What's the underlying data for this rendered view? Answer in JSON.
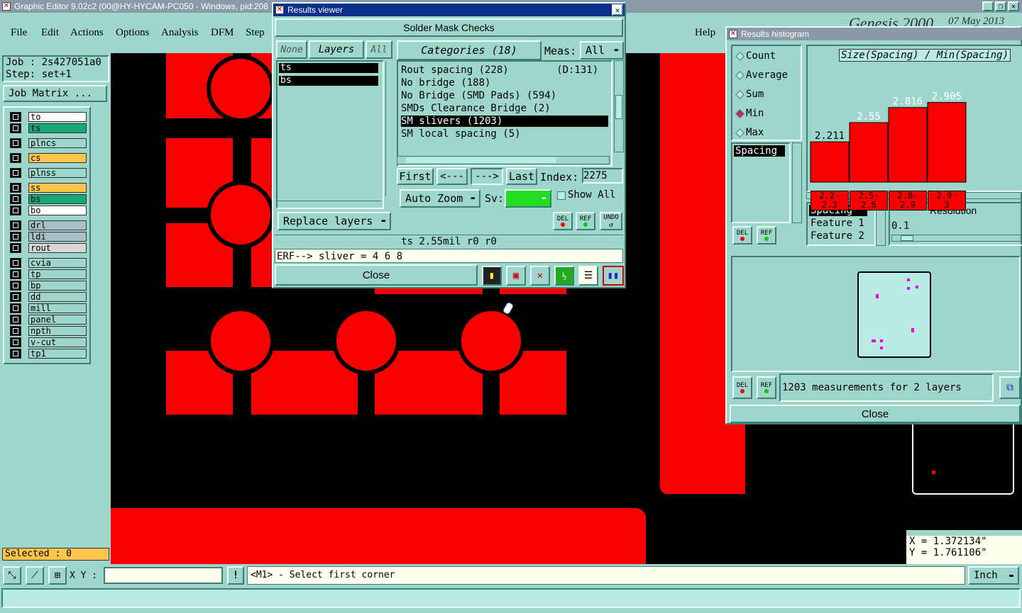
{
  "app_title": "Graphic Editor 9.02c2 (00@HY-HYCAM-PC050 - Windows, pid:208",
  "menu": [
    "File",
    "Edit",
    "Actions",
    "Options",
    "Analysis",
    "DFM",
    "Step"
  ],
  "help": "Help",
  "brand": "Genesis 2000",
  "date": "07 May 2013",
  "job": "Job : 2s427051a0",
  "step": "Step: set+1",
  "job_matrix": "Job Matrix ...",
  "layers": [
    {
      "name": "to",
      "color": "#ffffff"
    },
    {
      "name": "ts",
      "color": "#18a878"
    },
    {
      "name": "plncs",
      "color": "#9fd6cc"
    },
    {
      "name": "cs",
      "color": "#ffc44a"
    },
    {
      "name": "plnss",
      "color": "#9fd6cc"
    },
    {
      "name": "ss",
      "color": "#ffc44a"
    },
    {
      "name": "bs",
      "color": "#18a878"
    },
    {
      "name": "bo",
      "color": "#ffffff"
    },
    {
      "name": "drl",
      "color": "#a8c0c8"
    },
    {
      "name": "ldi",
      "color": "#a8c0c8"
    },
    {
      "name": "rout",
      "color": "#d8d8d8"
    },
    {
      "name": "cvia",
      "color": "#9fd6cc"
    },
    {
      "name": "tp",
      "color": "#9fd6cc"
    },
    {
      "name": "bp",
      "color": "#9fd6cc"
    },
    {
      "name": "dd",
      "color": "#9fd6cc"
    },
    {
      "name": "mill",
      "color": "#9fd6cc"
    },
    {
      "name": "panel",
      "color": "#9fd6cc"
    },
    {
      "name": "npth",
      "color": "#9fd6cc"
    },
    {
      "name": "v-cut",
      "color": "#9fd6cc"
    },
    {
      "name": "tp1",
      "color": "#9fd6cc"
    }
  ],
  "selected": "Selected : 0",
  "results_viewer": {
    "title": "Results viewer",
    "header": "Solder Mask Checks",
    "none": "None",
    "layers": "Layers",
    "all": "All",
    "layer_list": [
      "ts",
      "bs"
    ],
    "categories": "Categories (18)",
    "meas_label": "Meas:",
    "meas_value": "All",
    "category_list": [
      "Rout spacing (228)        (D:131)",
      "No bridge (188)",
      "No Bridge (SMD Pads) (594)",
      "SMDs Clearance Bridge (2)",
      "SM slivers (1203)",
      "SM local spacing (5)"
    ],
    "first": "First",
    "prev": "<---",
    "next": "--->",
    "last": "Last",
    "index_label": "Index:",
    "index_value": "2275",
    "auto_zoom": "Auto Zoom",
    "sv": "Sv:",
    "show_all": "Show All",
    "replace_layers": "Replace layers",
    "del": "DEL",
    "ref": "REF",
    "undo": "UNDO",
    "info": "ts 2.55mil  r0  r0",
    "erf": "ERF--> sliver = 4 6 8",
    "close": "Close"
  },
  "histogram": {
    "title": "Results histogram",
    "options": [
      "Count",
      "Average",
      "Sum",
      "Min",
      "Max"
    ],
    "selected_option": "Min",
    "field": "Spacing",
    "chart_title": "Size(Spacing) / Min(Spacing)",
    "fields": [
      "Spacing",
      "Feature 1",
      "Feature 2"
    ],
    "resolution_label": "Resolution",
    "resolution_value": "0.1",
    "summary": "1203 measurements for 2 layers",
    "close": "Close",
    "del": "DEL",
    "ref": "REF"
  },
  "chart_data": {
    "type": "bar",
    "categories": [
      "2.2-2.3",
      "2.5-2.6",
      "2.8-2.9",
      "2.9-3"
    ],
    "values": [
      2.211,
      2.55,
      2.816,
      2.905
    ],
    "title": "Size(Spacing) / Min(Spacing)",
    "ylim": [
      1.5,
      3.0
    ],
    "bar_color": "#f80000"
  },
  "coords": {
    "x": "X = 1.372134\"",
    "y": "Y = 1.761106\""
  },
  "xy_label": "X Y :",
  "status_msg": "<M1> - Select first corner",
  "units": "Inch",
  "colors": {
    "accent": "#0b2f8a",
    "copper": "#f80000",
    "panel": "#9fd6cc"
  }
}
